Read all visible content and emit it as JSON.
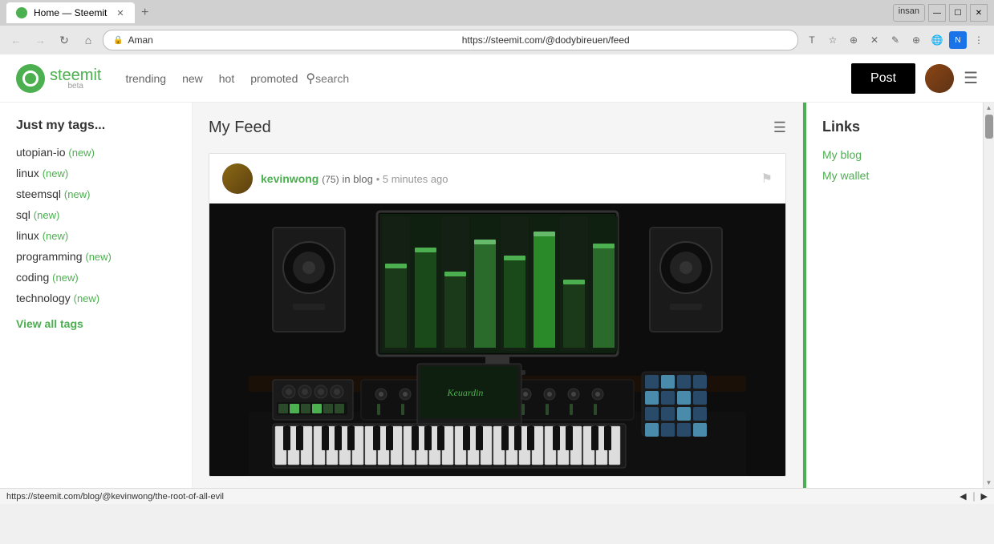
{
  "browser": {
    "title": "Home — Steemit",
    "tab_label": "Home — Steemit",
    "url": "https://steemit.com/@dodybireuen/feed",
    "user_label": "insan",
    "address_user": "Aman",
    "status_url": "https://steemit.com/blog/@kevinwong/the-root-of-all-evil"
  },
  "header": {
    "logo_text": "steemit",
    "logo_beta": "beta",
    "nav": {
      "trending": "trending",
      "new": "new",
      "hot": "hot",
      "promoted": "promoted"
    },
    "search_placeholder": "search",
    "post_button": "Post"
  },
  "sidebar": {
    "title": "Just my tags...",
    "tags": [
      {
        "name": "utopian-io",
        "badge": "(new)"
      },
      {
        "name": "linux",
        "badge": "(new)"
      },
      {
        "name": "steemsql",
        "badge": "(new)"
      },
      {
        "name": "sql",
        "badge": "(new)"
      },
      {
        "name": "linux",
        "badge": "(new)"
      },
      {
        "name": "programming",
        "badge": "(new)"
      },
      {
        "name": "coding",
        "badge": "(new)"
      },
      {
        "name": "technology",
        "badge": "(new)"
      }
    ],
    "view_all": "View all tags"
  },
  "feed": {
    "title": "My Feed",
    "post": {
      "author": "kevinwong",
      "author_rep": "(75)",
      "location": "in blog",
      "time": "5 minutes ago"
    }
  },
  "links": {
    "title": "Links",
    "items": [
      "My blog",
      "My wallet"
    ]
  }
}
